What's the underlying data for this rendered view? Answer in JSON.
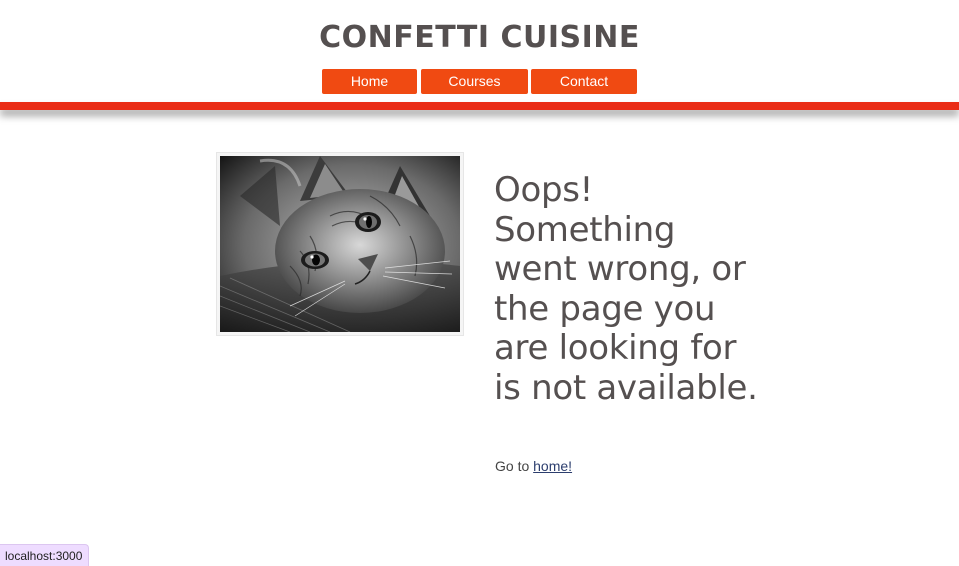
{
  "header": {
    "title": "CONFETTI CUISINE",
    "nav": [
      {
        "label": "Home"
      },
      {
        "label": "Courses"
      },
      {
        "label": "Contact"
      }
    ]
  },
  "colors": {
    "accent": "#f04a12",
    "accent_bar": "#ea2d17",
    "text": "#555050"
  },
  "main": {
    "image_subject": "cat-photo",
    "heading": "Oops! Something went wrong, or the page you are looking for is not available.",
    "goto_prefix": "Go to ",
    "goto_link": "home!"
  },
  "status_bar": {
    "url": "localhost:3000"
  }
}
